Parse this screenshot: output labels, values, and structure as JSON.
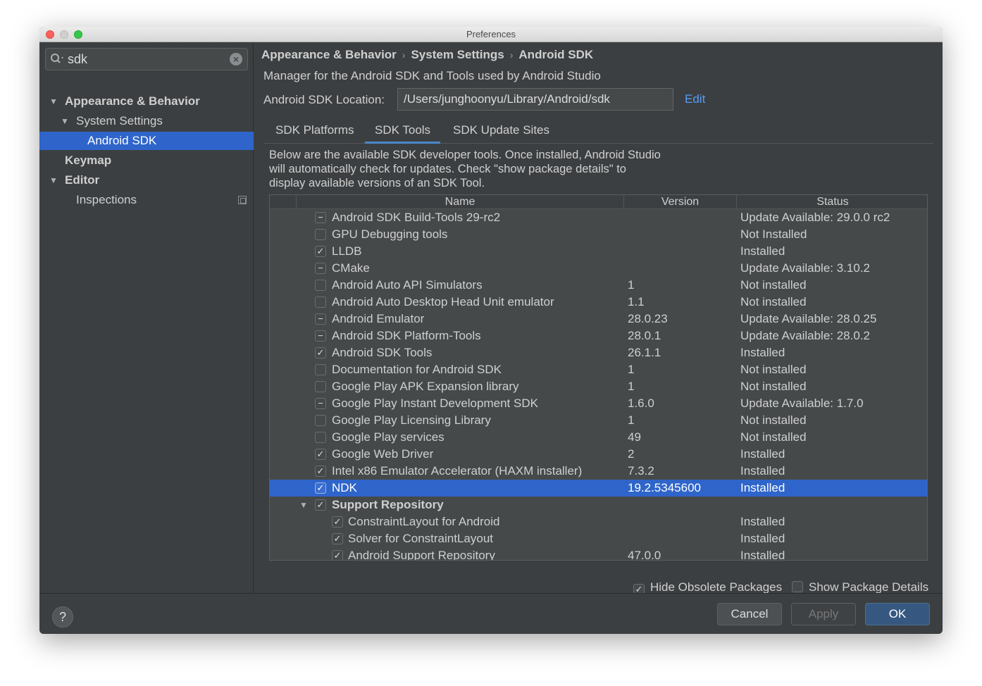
{
  "window": {
    "title": "Preferences"
  },
  "sidebar": {
    "search_value": "sdk",
    "items": [
      {
        "label": "Appearance & Behavior"
      },
      {
        "label": "System Settings"
      },
      {
        "label": "Android SDK"
      },
      {
        "label": "Keymap"
      },
      {
        "label": "Editor"
      },
      {
        "label": "Inspections"
      }
    ]
  },
  "main": {
    "breadcrumb": [
      "Appearance & Behavior",
      "System Settings",
      "Android SDK"
    ],
    "description": "Manager for the Android SDK and Tools used by Android Studio",
    "location_label": "Android SDK Location:",
    "location_value": "/Users/junghoonyu/Library/Android/sdk",
    "edit_label": "Edit",
    "tabs": [
      {
        "label": "SDK Platforms"
      },
      {
        "label": "SDK Tools",
        "active": true
      },
      {
        "label": "SDK Update Sites"
      }
    ],
    "intro_lines": [
      "Below are the available SDK developer tools. Once installed, Android Studio",
      "will automatically check for updates. Check \"show package details\" to",
      "display available versions of an SDK Tool."
    ]
  },
  "table": {
    "headers": {
      "name": "Name",
      "version": "Version",
      "status": "Status"
    },
    "rows": [
      {
        "name": "Android SDK Build-Tools 29-rc2",
        "version": "",
        "status": "Update Available: 29.0.0 rc2",
        "check": "partial"
      },
      {
        "name": "GPU Debugging tools",
        "version": "",
        "status": "Not Installed",
        "check": "none"
      },
      {
        "name": "LLDB",
        "version": "",
        "status": "Installed",
        "check": "checked"
      },
      {
        "name": "CMake",
        "version": "",
        "status": "Update Available: 3.10.2",
        "check": "partial"
      },
      {
        "name": "Android Auto API Simulators",
        "version": "1",
        "status": "Not installed",
        "check": "none"
      },
      {
        "name": "Android Auto Desktop Head Unit emulator",
        "version": "1.1",
        "status": "Not installed",
        "check": "none"
      },
      {
        "name": "Android Emulator",
        "version": "28.0.23",
        "status": "Update Available: 28.0.25",
        "check": "partial"
      },
      {
        "name": "Android SDK Platform-Tools",
        "version": "28.0.1",
        "status": "Update Available: 28.0.2",
        "check": "partial"
      },
      {
        "name": "Android SDK Tools",
        "version": "26.1.1",
        "status": "Installed",
        "check": "checked"
      },
      {
        "name": "Documentation for Android SDK",
        "version": "1",
        "status": "Not installed",
        "check": "none"
      },
      {
        "name": "Google Play APK Expansion library",
        "version": "1",
        "status": "Not installed",
        "check": "none"
      },
      {
        "name": "Google Play Instant Development SDK",
        "version": "1.6.0",
        "status": "Update Available: 1.7.0",
        "check": "partial"
      },
      {
        "name": "Google Play Licensing Library",
        "version": "1",
        "status": "Not installed",
        "check": "none"
      },
      {
        "name": "Google Play services",
        "version": "49",
        "status": "Not installed",
        "check": "none"
      },
      {
        "name": "Google Web Driver",
        "version": "2",
        "status": "Installed",
        "check": "checked"
      },
      {
        "name": "Intel x86 Emulator Accelerator (HAXM installer)",
        "version": "7.3.2",
        "status": "Installed",
        "check": "checked"
      },
      {
        "name": "NDK",
        "version": "19.2.5345600",
        "status": "Installed",
        "check": "checked",
        "selected": true
      },
      {
        "name": "Support Repository",
        "version": "",
        "status": "",
        "check": "checked",
        "group": true
      },
      {
        "name": "ConstraintLayout for Android",
        "version": "",
        "status": "Installed",
        "check": "checked",
        "child": true
      },
      {
        "name": "Solver for ConstraintLayout",
        "version": "",
        "status": "Installed",
        "check": "checked",
        "child": true
      },
      {
        "name": "Android Support Repository",
        "version": "47.0.0",
        "status": "Installed",
        "check": "checked",
        "child": true
      }
    ]
  },
  "options": {
    "hide_obsolete": "Hide Obsolete Packages",
    "show_details": "Show Package Details"
  },
  "footer": {
    "help": "?",
    "cancel": "Cancel",
    "apply": "Apply",
    "ok": "OK"
  }
}
